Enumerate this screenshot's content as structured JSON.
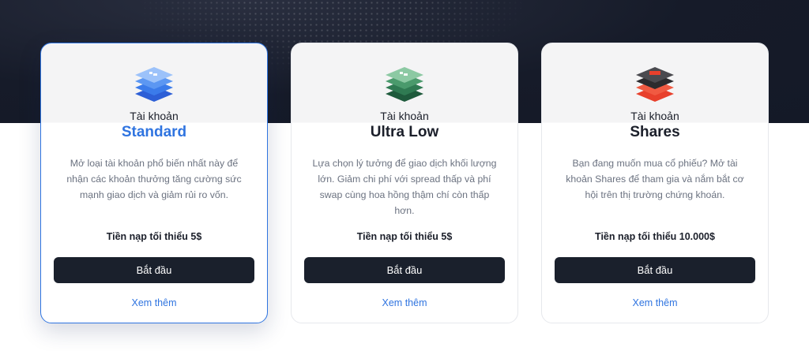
{
  "accent_color": "#2f74e0",
  "cards": [
    {
      "icon": "stacked-layers-blue-icon",
      "kicker": "Tài khoản",
      "name": "Standard",
      "description": "Mở loại tài khoản phổ biến nhất này để nhận các khoản thưởng tăng cường sức mạnh giao dịch và giảm rủi ro vốn.",
      "deposit": "Tiền nạp tối thiểu 5$",
      "button": "Bắt đầu",
      "more": "Xem thêm",
      "selected": true
    },
    {
      "icon": "stacked-layers-green-icon",
      "kicker": "Tài khoản",
      "name": "Ultra Low",
      "description": "Lựa chọn lý tưởng để giao dịch khối lượng lớn. Giảm chi phí với spread thấp và phí swap cùng hoa hồng thậm chí còn thấp hơn.",
      "deposit": "Tiền nạp tối thiểu 5$",
      "button": "Bắt đầu",
      "more": "Xem thêm",
      "selected": false
    },
    {
      "icon": "stacked-layers-red-icon",
      "kicker": "Tài khoản",
      "name": "Shares",
      "description": "Bạn đang muốn mua cổ phiếu? Mở tài khoản Shares để tham gia và nắm bắt cơ hội trên thị trường chứng khoán.",
      "deposit": "Tiền nạp tối thiểu 10.000$",
      "button": "Bắt đầu",
      "more": "Xem thêm",
      "selected": false
    }
  ]
}
